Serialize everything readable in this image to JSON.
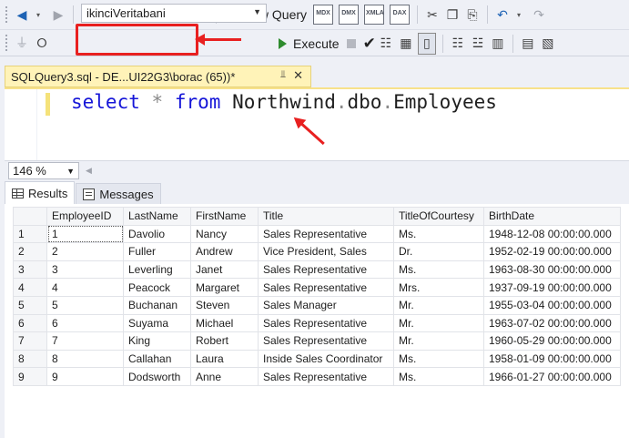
{
  "toolbar1": {
    "new_query_label": "New Query",
    "query_type_buttons": [
      "MDX",
      "DMX",
      "XMLA",
      "DAX"
    ]
  },
  "toolbar2": {
    "database": "ikinciVeritabani",
    "execute_label": "Execute"
  },
  "editor": {
    "tab_title": "SQLQuery3.sql - DE...UI22G3\\borac (65))*",
    "code": {
      "kw_select": "select",
      "star": "*",
      "kw_from": "from",
      "obj1": "Northwind",
      "obj2": "dbo",
      "obj3": "Employees"
    },
    "zoom": "146 %"
  },
  "results": {
    "tabs": [
      "Results",
      "Messages"
    ],
    "columns": [
      "EmployeeID",
      "LastName",
      "FirstName",
      "Title",
      "TitleOfCourtesy",
      "BirthDate"
    ],
    "rows": [
      [
        "1",
        "1",
        "Davolio",
        "Nancy",
        "Sales Representative",
        "Ms.",
        "1948-12-08 00:00:00.000"
      ],
      [
        "2",
        "2",
        "Fuller",
        "Andrew",
        "Vice President, Sales",
        "Dr.",
        "1952-02-19 00:00:00.000"
      ],
      [
        "3",
        "3",
        "Leverling",
        "Janet",
        "Sales Representative",
        "Ms.",
        "1963-08-30 00:00:00.000"
      ],
      [
        "4",
        "4",
        "Peacock",
        "Margaret",
        "Sales Representative",
        "Mrs.",
        "1937-09-19 00:00:00.000"
      ],
      [
        "5",
        "5",
        "Buchanan",
        "Steven",
        "Sales Manager",
        "Mr.",
        "1955-03-04 00:00:00.000"
      ],
      [
        "6",
        "6",
        "Suyama",
        "Michael",
        "Sales Representative",
        "Mr.",
        "1963-07-02 00:00:00.000"
      ],
      [
        "7",
        "7",
        "King",
        "Robert",
        "Sales Representative",
        "Mr.",
        "1960-05-29 00:00:00.000"
      ],
      [
        "8",
        "8",
        "Callahan",
        "Laura",
        "Inside Sales Coordinator",
        "Ms.",
        "1958-01-09 00:00:00.000"
      ],
      [
        "9",
        "9",
        "Dodsworth",
        "Anne",
        "Sales Representative",
        "Ms.",
        "1966-01-27 00:00:00.000"
      ]
    ]
  },
  "annotation_color": "#e82020"
}
